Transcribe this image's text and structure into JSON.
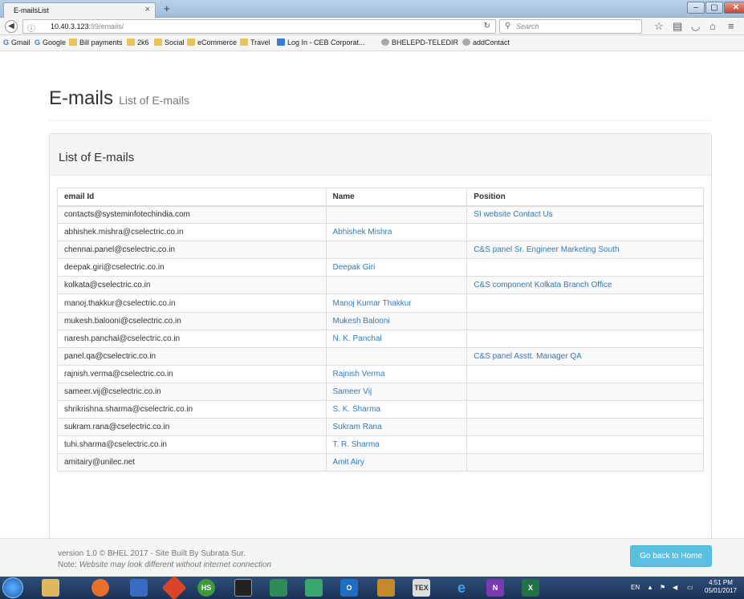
{
  "browser": {
    "tab_title": "E-mailsList",
    "tab_close": "×",
    "new_tab": "+",
    "url_host": "10.40.3.123",
    "url_rest": ":99/emails/",
    "search_placeholder": "Search",
    "window_controls": {
      "minimize": "–",
      "maximize": "▢",
      "close": "✕"
    }
  },
  "bookmarks": [
    {
      "label": "Gmail",
      "icon": "google-g-icon"
    },
    {
      "label": "Google",
      "icon": "google-g-icon"
    },
    {
      "label": "Bill payments",
      "icon": "folder-icon"
    },
    {
      "label": "2k6",
      "icon": "folder-icon"
    },
    {
      "label": "Social",
      "icon": "folder-icon"
    },
    {
      "label": "eCommerce",
      "icon": "folder-icon"
    },
    {
      "label": "Travel",
      "icon": "folder-icon"
    },
    {
      "label": "Log In - CEB Corporat...",
      "icon": "document-icon"
    },
    {
      "label": "BHELEPD-TELEDIR",
      "icon": "globe-icon"
    },
    {
      "label": "addContact",
      "icon": "globe-icon"
    }
  ],
  "page": {
    "title": "E-mails",
    "subtitle": "List of E-mails",
    "panel_title": "List of E-mails"
  },
  "table": {
    "headers": [
      "email Id",
      "Name",
      "Position"
    ],
    "rows": [
      [
        "contacts@systeminfotechindia.com",
        "",
        "SI website Contact Us"
      ],
      [
        "abhishek.mishra@cselectric.co.in",
        "Abhishek Mishra",
        ""
      ],
      [
        "chennai.panel@cselectric.co.in",
        "",
        "C&S panel Sr. Engineer Marketing South"
      ],
      [
        "deepak.giri@cselectric.co.in",
        "Deepak Giri",
        ""
      ],
      [
        "kolkata@cselectric.co.in",
        "",
        "C&S component Kolkata Branch Office"
      ],
      [
        "manoj.thakkur@cselectric.co.in",
        "Manoj Kumar Thakkur",
        ""
      ],
      [
        "mukesh.balooni@cselectric.co.in",
        "Mukesh Balooni",
        ""
      ],
      [
        "naresh.panchal@cselectric.co.in",
        "N. K. Panchal",
        ""
      ],
      [
        "panel.qa@cselectric.co.in",
        "",
        "C&S panel Asstt. Manager QA"
      ],
      [
        "rajnish.verma@cselectric.co.in",
        "Rajnish Verma",
        ""
      ],
      [
        "sameer.vij@cselectric.co.in",
        "Sameer Vij",
        ""
      ],
      [
        "shrikrishna.sharma@cselectric.co.in",
        "S. K. Sharma",
        ""
      ],
      [
        "sukram.rana@cselectric.co.in",
        "Sukram Rana",
        ""
      ],
      [
        "tuhi.sharma@cselectric.co.in",
        "T. R. Sharma",
        ""
      ],
      [
        "amitairy@unilec.net",
        "Amit Airy",
        ""
      ]
    ]
  },
  "footer": {
    "version": "version 1.0 © BHEL 2017 - Site Built By Subrata Sur.",
    "note_label": "Note: ",
    "note_text": "Website may look different without internet connection",
    "home_button": "Go back to Home"
  },
  "taskbar": {
    "lang": "EN",
    "time": "4:51 PM",
    "date": "05/01/2017"
  },
  "colors": {
    "link": "#337ab7",
    "info_button": "#5bc0de"
  }
}
